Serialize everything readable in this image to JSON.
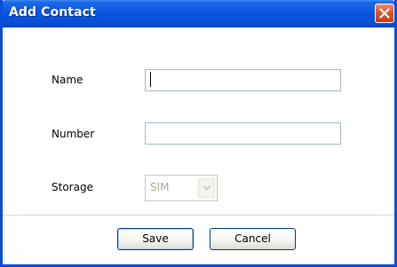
{
  "dialog": {
    "title": "Add Contact",
    "close_icon": "close-icon"
  },
  "form": {
    "name_label": "Name",
    "name_value": "",
    "number_label": "Number",
    "number_value": "",
    "storage_label": "Storage",
    "storage_value": "SIM",
    "storage_enabled": false
  },
  "buttons": {
    "save_label": "Save",
    "cancel_label": "Cancel"
  },
  "colors": {
    "titlebar": "#0850d6",
    "close_button": "#e0552b",
    "button_border": "#003c74"
  }
}
